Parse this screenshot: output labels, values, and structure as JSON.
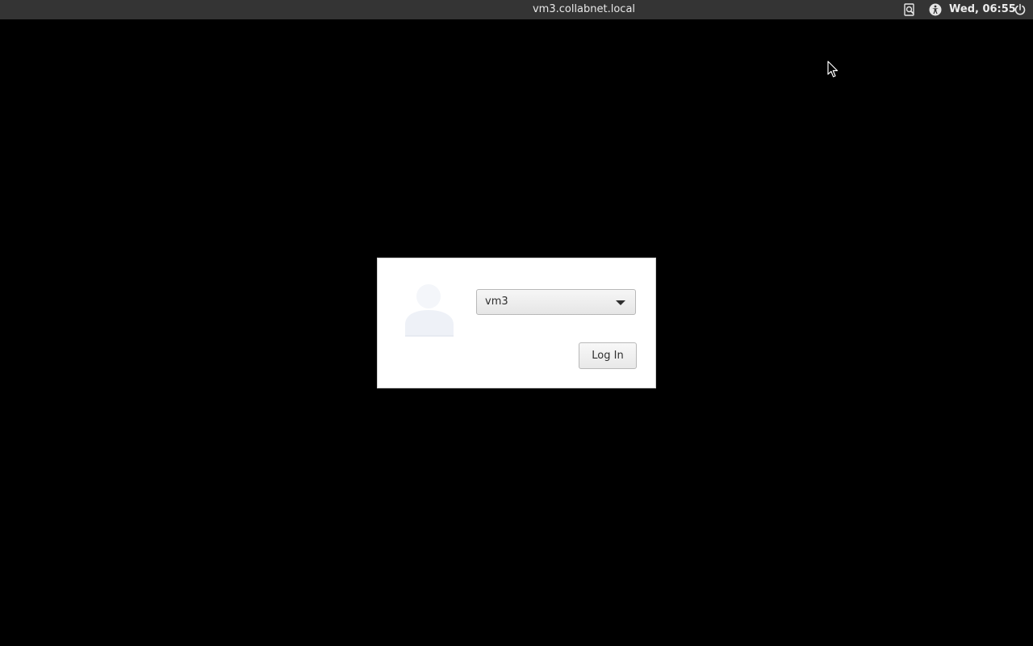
{
  "top_bar": {
    "hostname": "vm3.collabnet.local",
    "clock": "Wed, 06:55",
    "icons": [
      "input-method-icon",
      "accessibility-icon",
      "power-icon"
    ]
  },
  "login": {
    "selected_user": "vm3",
    "login_button_label": "Log In"
  },
  "colors": {
    "panel_background": "#343434",
    "desktop_background": "#000000",
    "dialog_background": "#ffffff"
  }
}
